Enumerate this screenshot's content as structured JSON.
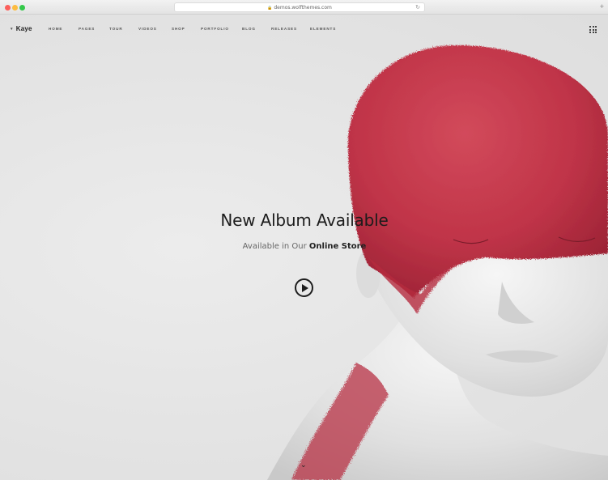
{
  "browser": {
    "url": "demos.wolfthemes.com"
  },
  "nav": {
    "logo": "Kaye",
    "items": [
      "HOME",
      "PAGES",
      "TOUR",
      "VIDEOS",
      "SHOP",
      "PORTFOLIO",
      "BLOG",
      "RELEASES",
      "ELEMENTS"
    ]
  },
  "hero": {
    "title": "New Album Available",
    "subtitle_prefix": "Available in Our",
    "subtitle_link": "Online Store"
  },
  "colors": {
    "accent_red": "#c8364a",
    "text_dark": "#1c1c1c",
    "background": "#e7e7e7"
  },
  "icons": {
    "menu_toggle": "grid-icon",
    "play": "play-icon",
    "scroll": "chevron-down-icon"
  }
}
